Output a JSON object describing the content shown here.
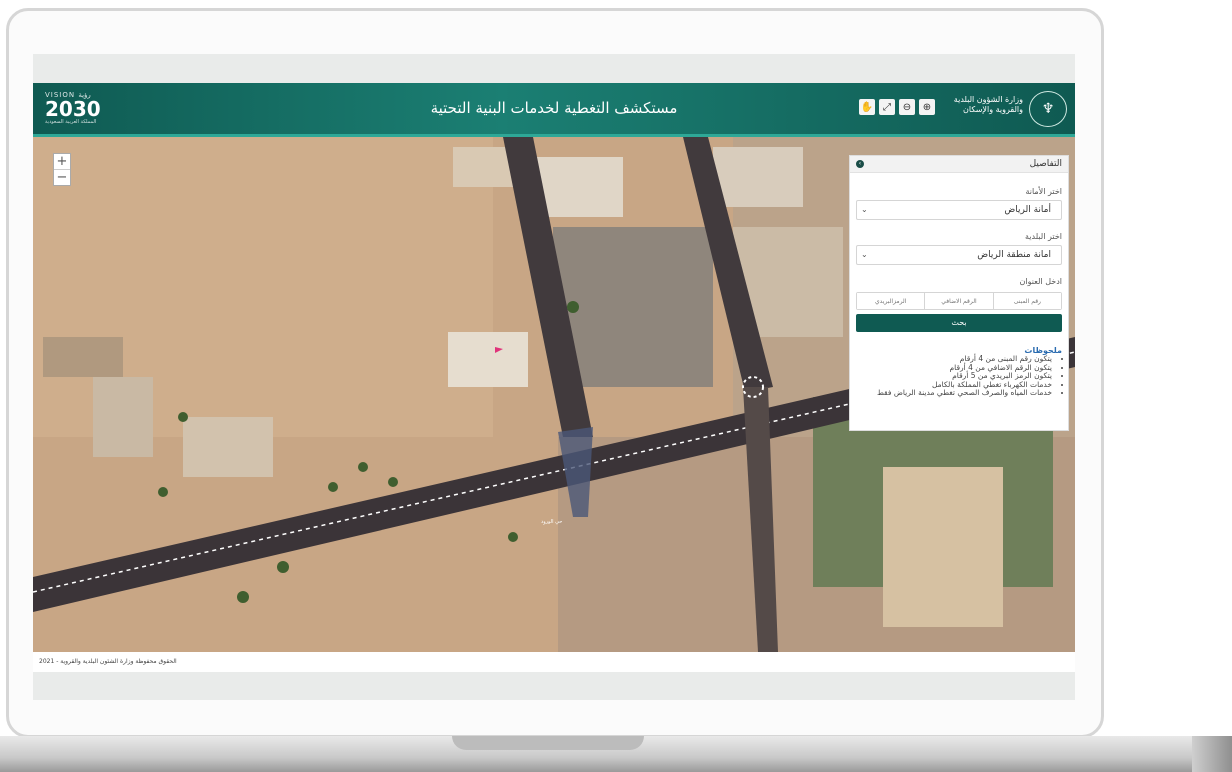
{
  "header": {
    "title": "مستكشف التغطية لخدمات البنية التحتية",
    "vision_logo": {
      "top": "VISION رؤية",
      "number": "2030",
      "caption": "المملكة العربية السعودية"
    },
    "ministry_logo": {
      "line1": "وزارة الشؤون البلدية",
      "line2": "والقروية والإسكان"
    },
    "tools": [
      "hand-icon",
      "fullscreen-icon",
      "zoom-out-icon",
      "zoom-in-icon"
    ]
  },
  "map": {
    "zoom_in": "+",
    "zoom_out": "−",
    "place_label": "حي الورود"
  },
  "panel": {
    "title": "التفاصيل",
    "collapse": "›",
    "amanah_label": "اختر الأمانة",
    "amanah_value": "أمانة الرياض",
    "baladiya_label": "اختر البلدية",
    "baladiya_value": "امانة منطقة الرياض",
    "address_label": "ادخل العنوان",
    "building_placeholder": "رقم المبنى",
    "additional_placeholder": "الرقم الاضافي",
    "postal_placeholder": "الرمزالبريدي",
    "search_label": "بحث",
    "notes_title": "ملحوظات",
    "notes": [
      "يتكون رقم المبنى من 4 أرقام",
      "يتكون الرقم الاضافي من 4 أرقام",
      "يتكون الرمز البريدي من 5 أرقام",
      "خدمات الكهرباء تغطي المملكة بالكامل",
      "خدمات المياه والصرف الصحي تغطي مدينة الرياض فقط"
    ]
  },
  "footer": {
    "copyright": "الحقوق محفوظة وزارة الشئون البلدية والقروية - 2021"
  },
  "colors": {
    "header": "#0f5a52",
    "accent": "#2ea897",
    "button": "#0f5a52",
    "notes_title": "#2b6cb0"
  }
}
